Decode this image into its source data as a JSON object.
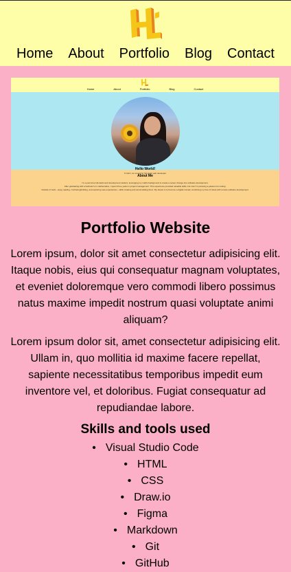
{
  "header": {
    "logo_icon": "hl-monogram-icon",
    "brand_color": "#f5c518",
    "nav": [
      {
        "label": "Home"
      },
      {
        "label": "About"
      },
      {
        "label": "Portfolio"
      },
      {
        "label": "Blog"
      },
      {
        "label": "Contact"
      }
    ]
  },
  "screenshot": {
    "nav": [
      "Home",
      "About",
      "Portfolio",
      "Blog",
      "Contact"
    ],
    "hello": "Hello World!",
    "subtitle": "I'm Erin, an emerging full-stack web developer",
    "about_title": "About Me",
    "about_lines": [
      "I'm a part-time full-stack web development student, leveraging my maths background to create a career change into software development.",
      "After graduating with a bachelor's in mathematics, I spent three years in project management. This experience provided valuable skills, but now I'm pursuing a passion for coding.",
      "Outside of work - enjoy reading, crocheting/knitting, and exploring new experiences - skills creating and accumulating them. My dream is to become a digital nomad, combining my love of travel with remote software development."
    ]
  },
  "project": {
    "title": "Portfolio Website",
    "paragraph1": "Lorem ipsum, dolor sit amet consectetur adipisicing elit. Itaque nobis, eius qui consequatur magnam voluptates, et eveniet doloremque vero commodi libero possimus natus maxime impedit nostrum quasi voluptate animi aliquam?",
    "paragraph2": "Lorem ipsum dolor sit, amet consectetur adipisicing elit. Ullam in, quo mollitia id maxime facere repellat, sapiente necessitatibus temporibus impedit eum inventore vel, et doloribus. Fugiat consequatur ad repudiandae labore.",
    "skills_title": "Skills and tools used",
    "skills": [
      "Visual Studio Code",
      "HTML",
      "CSS",
      "Draw.io",
      "Figma",
      "Markdown",
      "Git",
      "GitHub"
    ]
  }
}
